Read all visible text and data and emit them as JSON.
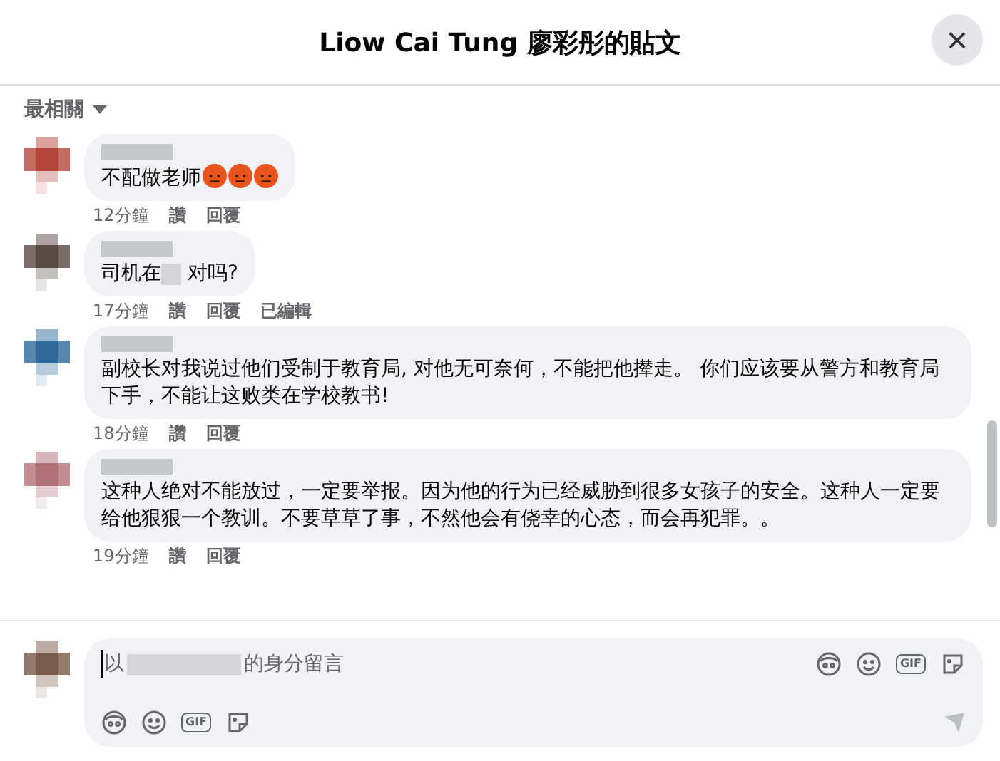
{
  "dialog": {
    "title": "Liow Cai Tung 廖彩彤的貼文",
    "close": "×"
  },
  "sort": {
    "label": "最相關"
  },
  "comments": [
    {
      "color": "#b5463c",
      "segments": [
        {
          "kind": "text",
          "text": "不配做老师"
        },
        {
          "kind": "emoji"
        },
        {
          "kind": "emoji"
        },
        {
          "kind": "emoji"
        }
      ],
      "time": "12分鐘",
      "actions": [
        "讚",
        "回覆"
      ]
    },
    {
      "color": "#5a4a44",
      "segments": [
        {
          "kind": "text",
          "text": "司机在"
        },
        {
          "kind": "redacted"
        },
        {
          "kind": "text",
          "text": " 对吗?"
        }
      ],
      "time": "17分鐘",
      "actions": [
        "讚",
        "回覆",
        "已編輯"
      ]
    },
    {
      "color": "#2f6a9a",
      "segments": [
        {
          "kind": "text",
          "text": "副校长对我说过他们受制于教育局, 对他无可奈何，不能把他撵走。 你们应该要从警方和教育局下手，不能让这败类在学校教书!"
        }
      ],
      "time": "18分鐘",
      "actions": [
        "讚",
        "回覆"
      ]
    },
    {
      "color": "#b07078",
      "segments": [
        {
          "kind": "text",
          "text": "这种人绝对不能放过，一定要举报。因为他的行为已经威胁到很多女孩子的安全。这种人一定要给他狠狠一个教训。不要草草了事，不然他会有侥幸的心态，而会再犯罪。。"
        }
      ],
      "time": "19分鐘",
      "actions": [
        "讚",
        "回覆"
      ]
    }
  ],
  "composer": {
    "color": "#7a5a4a",
    "placeholder_prefix": "以",
    "placeholder_suffix": "的身分留言",
    "top_tools": [
      {
        "kind": "avatar"
      },
      {
        "kind": "emoji"
      },
      {
        "kind": "gif",
        "label": "GIF"
      },
      {
        "kind": "sticker"
      }
    ],
    "bottom_tools": [
      {
        "kind": "avatar"
      },
      {
        "kind": "emoji"
      },
      {
        "kind": "gif",
        "label": "GIF"
      },
      {
        "kind": "sticker"
      }
    ]
  }
}
